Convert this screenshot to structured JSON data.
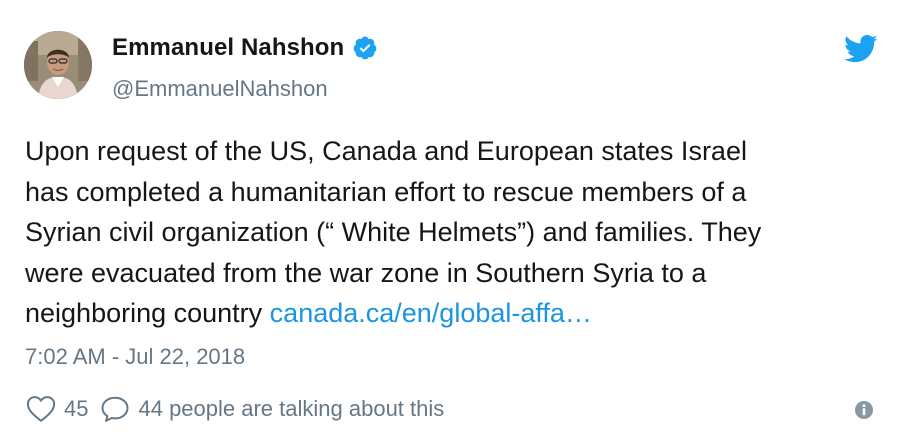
{
  "author": {
    "name": "Emmanuel Nahshon",
    "handle": "@EmmanuelNahshon",
    "verified": true,
    "avatar": "avatar-photo"
  },
  "tweet": {
    "lines": [
      "Upon request of the US, Canada and European states Israel",
      "has completed a humanitarian effort to rescue members of a",
      "Syrian civil organization (“ White Helmets”) and families. They",
      "were evacuated from the war zone in Southern Syria to a"
    ],
    "last_line_text": "neighboring country ",
    "link_text": "canada.ca/en/global-affa…"
  },
  "timestamp": "7:02 AM - Jul 22, 2018",
  "actions": {
    "like_count": "45",
    "talking": "44 people are talking about this"
  },
  "icons": {
    "brand": "twitter-bird-icon",
    "verified": "verified-badge-icon",
    "like": "heart-icon",
    "reply": "speech-bubble-icon",
    "info": "info-icon"
  },
  "colors": {
    "twitter_blue": "#1da1f2",
    "link": "#1b95e0",
    "muted": "#657786",
    "text": "#14171a"
  }
}
